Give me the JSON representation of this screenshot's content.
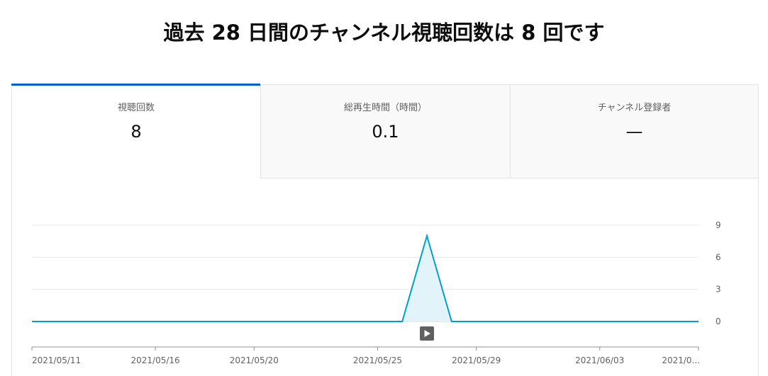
{
  "headline": "過去 28 日間のチャンネル視聴回数は 8 回です",
  "tabs": [
    {
      "label": "視聴回数",
      "value": "8",
      "active": true
    },
    {
      "label": "総再生時間（時間）",
      "value": "0.1",
      "active": false
    },
    {
      "label": "チャンネル登録者",
      "value": "—",
      "active": false
    }
  ],
  "colors": {
    "accent": "#065fd4",
    "line": "#00a0c8",
    "area": "#e2f4f9"
  },
  "chart_data": {
    "type": "area",
    "x": [
      "2021/05/11",
      "2021/05/12",
      "2021/05/13",
      "2021/05/14",
      "2021/05/15",
      "2021/05/16",
      "2021/05/17",
      "2021/05/18",
      "2021/05/19",
      "2021/05/20",
      "2021/05/21",
      "2021/05/22",
      "2021/05/23",
      "2021/05/24",
      "2021/05/25",
      "2021/05/26",
      "2021/05/27",
      "2021/05/28",
      "2021/05/29",
      "2021/05/30",
      "2021/05/31",
      "2021/06/01",
      "2021/06/02",
      "2021/06/03",
      "2021/06/04",
      "2021/06/05",
      "2021/06/06",
      "2021/06/07"
    ],
    "series": [
      {
        "values": [
          0,
          0,
          0,
          0,
          0,
          0,
          0,
          0,
          0,
          0,
          0,
          0,
          0,
          0,
          0,
          0,
          8,
          0,
          0,
          0,
          0,
          0,
          0,
          0,
          0,
          0,
          0,
          0
        ]
      }
    ],
    "x_tick_labels": [
      "2021/05/11",
      "2021/05/16",
      "2021/05/20",
      "2021/05/25",
      "2021/05/29",
      "2021/06/03",
      "2021/0..."
    ],
    "x_tick_dates": [
      "2021/05/11",
      "2021/05/16",
      "2021/05/20",
      "2021/05/25",
      "2021/05/29",
      "2021/06/03",
      "2021/06/07"
    ],
    "y_ticks": [
      0,
      3,
      6,
      9
    ],
    "ylim": [
      0,
      9
    ],
    "grid": true,
    "marker_icon": "video-play-icon",
    "marker_date": "2021/05/27"
  }
}
